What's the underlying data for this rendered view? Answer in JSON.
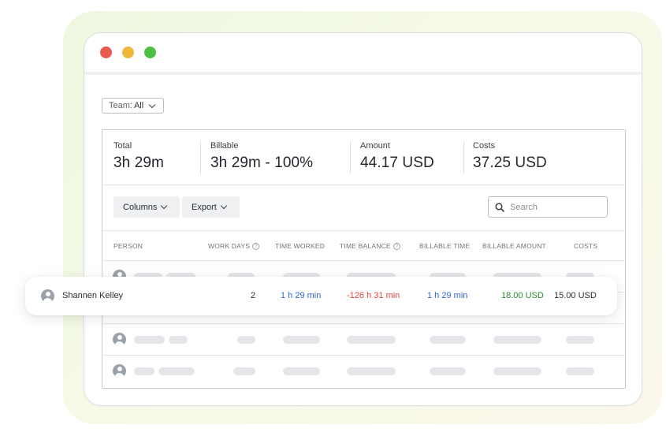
{
  "team_filter": {
    "label": "Team:",
    "value": "All"
  },
  "stats": [
    {
      "label": "Total",
      "value": "3h 29m"
    },
    {
      "label": "Billable",
      "value": "3h 29m - 100%"
    },
    {
      "label": "Amount",
      "value": "44.17 USD"
    },
    {
      "label": "Costs",
      "value": "37.25 USD"
    }
  ],
  "toolbar": {
    "columns_label": "Columns",
    "export_label": "Export",
    "search_placeholder": "Search"
  },
  "columns": {
    "person": "PERSON",
    "work_days": "WORK DAYS",
    "time_worked": "TIME WORKED",
    "time_balance": "TIME BALANCE",
    "billable_time": "BILLABLE TIME",
    "billable_amount": "BILLABLE AMOUNT",
    "costs": "COSTS"
  },
  "highlighted_row": {
    "person": "Shannen Kelley",
    "work_days": "2",
    "time_worked": "1 h 29 min",
    "time_balance": "-126 h 31 min",
    "billable_time": "1 h 29 min",
    "billable_amount": "18.00 USD",
    "costs": "15.00 USD"
  },
  "colors": {
    "positive_time": "#2f66d6",
    "negative_time": "#e5473d",
    "billable_amount": "#2f8a2f",
    "window_dots": [
      "#ea5a4e",
      "#f0b83a",
      "#4fbf45"
    ]
  }
}
